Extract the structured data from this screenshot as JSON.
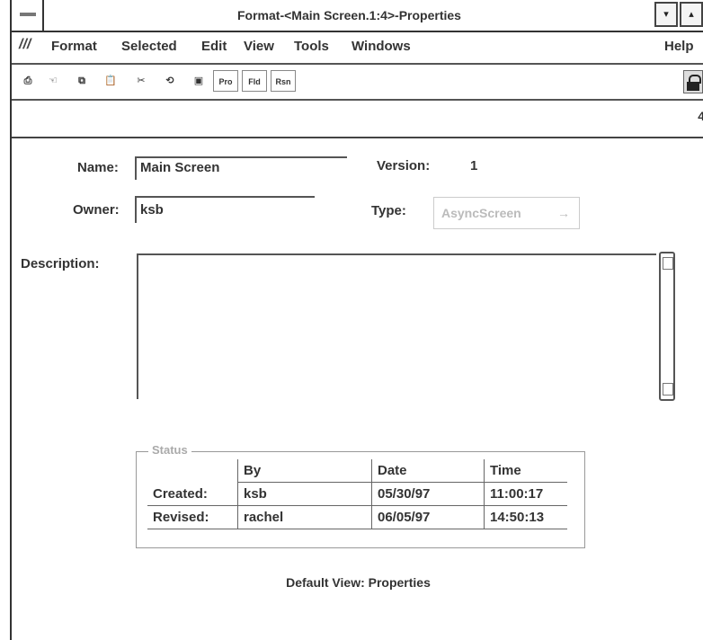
{
  "window": {
    "title": "Format-<Main Screen.1:4>-Properties",
    "minimize_glyph": "▾",
    "maximize_glyph": "▴"
  },
  "menubar": {
    "items": [
      "Format",
      "Selected",
      "Edit",
      "View",
      "Tools",
      "Windows"
    ],
    "help": "Help"
  },
  "toolbar": {
    "buttons": [
      {
        "icon": "print-icon",
        "glyph": "⎙"
      },
      {
        "icon": "pointer-icon",
        "glyph": "☜"
      },
      {
        "icon": "copy-icon",
        "glyph": "⧉"
      },
      {
        "icon": "clipboard-icon",
        "glyph": "📋"
      },
      {
        "icon": "cut-icon",
        "glyph": "✂"
      },
      {
        "icon": "refresh-icon",
        "glyph": "⟲"
      },
      {
        "icon": "save-icon",
        "glyph": "▣"
      }
    ],
    "text_buttons": [
      "Pro",
      "Fld",
      "Rsn"
    ]
  },
  "strip": {
    "number": "4"
  },
  "form": {
    "name_label": "Name:",
    "name_value": "Main Screen",
    "owner_label": "Owner:",
    "owner_value": "ksb",
    "version_label": "Version:",
    "version_value": "1",
    "type_label": "Type:",
    "type_value": "AsyncScreen",
    "description_label": "Description:",
    "description_value": ""
  },
  "status": {
    "group_label": "Status",
    "columns": [
      "",
      "By",
      "Date",
      "Time"
    ],
    "rows": [
      [
        "Created:",
        "ksb",
        "05/30/97",
        "11:00:17"
      ],
      [
        "Revised:",
        "rachel",
        "06/05/97",
        "14:50:13"
      ]
    ]
  },
  "footer": {
    "default_view": "Default View: Properties"
  }
}
